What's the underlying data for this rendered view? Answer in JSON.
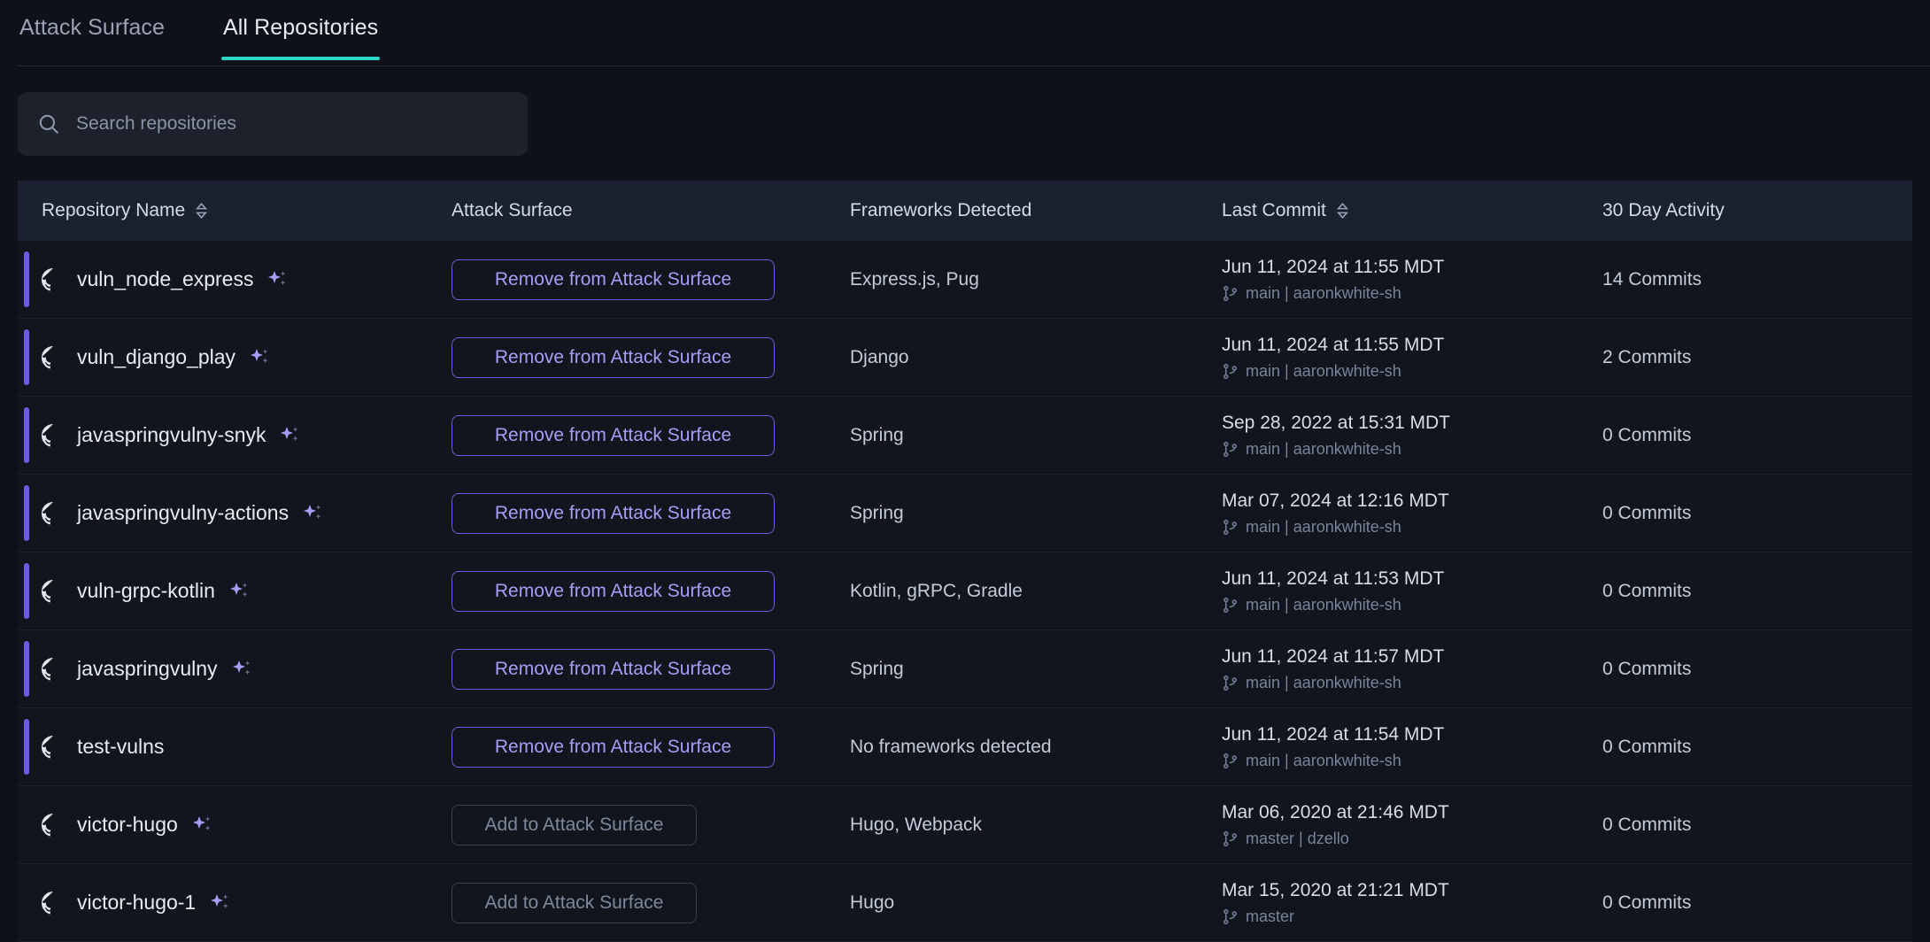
{
  "tabs": [
    {
      "label": "Attack Surface",
      "active": false
    },
    {
      "label": "All Repositories",
      "active": true
    }
  ],
  "search": {
    "placeholder": "Search repositories",
    "value": "",
    "icon": "search-icon"
  },
  "table": {
    "columns": [
      {
        "label": "Repository Name",
        "sortable": true
      },
      {
        "label": "Attack Surface",
        "sortable": false
      },
      {
        "label": "Frameworks Detected",
        "sortable": false
      },
      {
        "label": "Last Commit",
        "sortable": true
      },
      {
        "label": "30 Day Activity",
        "sortable": false
      }
    ],
    "rows": [
      {
        "name": "vuln_node_express",
        "sparkle": true,
        "on_surface": true,
        "action_label": "Remove from Attack Surface",
        "frameworks": "Express.js, Pug",
        "commit_date": "Jun 11, 2024 at 11:55 MDT",
        "branch": "main",
        "author": "aaronkwhite-sh",
        "activity": "14 Commits"
      },
      {
        "name": "vuln_django_play",
        "sparkle": true,
        "on_surface": true,
        "action_label": "Remove from Attack Surface",
        "frameworks": "Django",
        "commit_date": "Jun 11, 2024 at 11:55 MDT",
        "branch": "main",
        "author": "aaronkwhite-sh",
        "activity": "2 Commits"
      },
      {
        "name": "javaspringvulny-snyk",
        "sparkle": true,
        "on_surface": true,
        "action_label": "Remove from Attack Surface",
        "frameworks": "Spring",
        "commit_date": "Sep 28, 2022 at 15:31 MDT",
        "branch": "main",
        "author": "aaronkwhite-sh",
        "activity": "0 Commits"
      },
      {
        "name": "javaspringvulny-actions",
        "sparkle": true,
        "on_surface": true,
        "action_label": "Remove from Attack Surface",
        "frameworks": "Spring",
        "commit_date": "Mar 07, 2024 at 12:16 MDT",
        "branch": "main",
        "author": "aaronkwhite-sh",
        "activity": "0 Commits"
      },
      {
        "name": "vuln-grpc-kotlin",
        "sparkle": true,
        "on_surface": true,
        "action_label": "Remove from Attack Surface",
        "frameworks": "Kotlin, gRPC, Gradle",
        "commit_date": "Jun 11, 2024 at 11:53 MDT",
        "branch": "main",
        "author": "aaronkwhite-sh",
        "activity": "0 Commits"
      },
      {
        "name": "javaspringvulny",
        "sparkle": true,
        "on_surface": true,
        "action_label": "Remove from Attack Surface",
        "frameworks": "Spring",
        "commit_date": "Jun 11, 2024 at 11:57 MDT",
        "branch": "main",
        "author": "aaronkwhite-sh",
        "activity": "0 Commits"
      },
      {
        "name": "test-vulns",
        "sparkle": false,
        "on_surface": true,
        "action_label": "Remove from Attack Surface",
        "frameworks": "No frameworks detected",
        "commit_date": "Jun 11, 2024 at 11:54 MDT",
        "branch": "main",
        "author": "aaronkwhite-sh",
        "activity": "0 Commits"
      },
      {
        "name": "victor-hugo",
        "sparkle": true,
        "on_surface": false,
        "action_label": "Add to Attack Surface",
        "frameworks": "Hugo, Webpack",
        "commit_date": "Mar 06, 2020 at 21:46 MDT",
        "branch": "master",
        "author": "dzello",
        "activity": "0 Commits"
      },
      {
        "name": "victor-hugo-1",
        "sparkle": true,
        "on_surface": false,
        "action_label": "Add to Attack Surface",
        "frameworks": "Hugo",
        "commit_date": "Mar 15, 2020 at 21:21 MDT",
        "branch": "master",
        "author": "",
        "activity": "0 Commits"
      }
    ]
  },
  "colors": {
    "page_bg": "#0E1119",
    "tab_accent": "#2DD4C8",
    "row_accent": "#6B5BE6",
    "button_purple": "#A99CF5",
    "header_bg": "#1C2130"
  }
}
